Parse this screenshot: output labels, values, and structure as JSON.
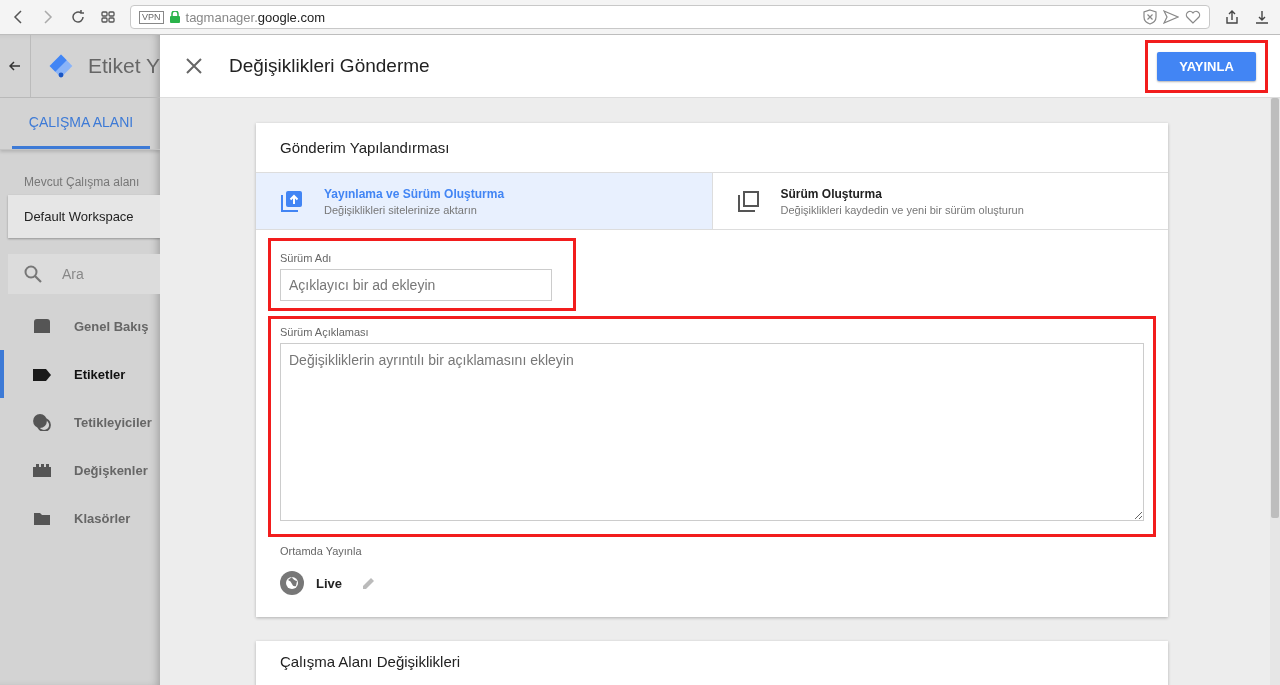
{
  "browser": {
    "vpn_badge": "VPN",
    "url_host": "tagmanager.",
    "url_domain": "google.com"
  },
  "sidebar": {
    "title": "Etiket Y",
    "tabs": [
      {
        "label": "ÇALIŞMA ALANI",
        "selected": true
      }
    ],
    "workspace_label": "Mevcut Çalışma alanı",
    "workspace": "Default Workspace",
    "search": {
      "placeholder": "Ara"
    },
    "items": [
      {
        "label": "Genel Bakış",
        "kind": "overview",
        "selected": false
      },
      {
        "label": "Etiketler",
        "kind": "tags",
        "selected": true
      },
      {
        "label": "Tetikleyiciler",
        "kind": "triggers",
        "selected": false
      },
      {
        "label": "Değişkenler",
        "kind": "variables",
        "selected": false
      },
      {
        "label": "Klasörler",
        "kind": "folders",
        "selected": false
      }
    ]
  },
  "panel": {
    "title": "Değişiklikleri Gönderme",
    "publish_button": {
      "label": "YAYINLA",
      "highlighted": true
    },
    "config_card": {
      "title": "Gönderim Yapılandırması",
      "options": [
        {
          "kind": "publish",
          "title": "Yayınlama ve Sürüm Oluşturma",
          "subtitle": "Değişiklikleri sitelerinize aktarın",
          "selected": true
        },
        {
          "kind": "version",
          "title": "Sürüm Oluşturma",
          "subtitle": "Değişiklikleri kaydedin ve yeni bir sürüm oluşturun",
          "selected": false
        }
      ],
      "version_name": {
        "label": "Sürüm Adı",
        "placeholder": "Açıklayıcı bir ad ekleyin",
        "highlighted": true
      },
      "version_description": {
        "label": "Sürüm Açıklaması",
        "placeholder": "Değişikliklerin ayrıntılı bir açıklamasını ekleyin",
        "highlighted": true
      },
      "environment_label": "Ortamda Yayınla",
      "environment": "Live"
    },
    "changes_card": {
      "title": "Çalışma Alanı Değişiklikleri"
    }
  }
}
